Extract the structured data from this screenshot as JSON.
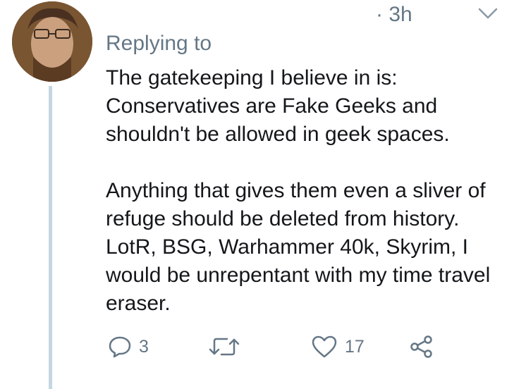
{
  "tweet": {
    "time": "· 3h",
    "replying_label": "Replying to",
    "paragraphs": [
      "The gatekeeping I believe in is: Conservatives are Fake Geeks and shouldn't be allowed in geek spaces.",
      "Anything that gives them even a sliver of refuge should be deleted from history. LotR, BSG, Warhammer 40k, Skyrim, I would be unrepentant with my time travel eraser."
    ],
    "reply_count": "3",
    "retweet_count": "",
    "like_count": "17"
  },
  "icons": {
    "menu": "chevron-down-icon",
    "reply": "speech-bubble-icon",
    "retweet": "retweet-icon",
    "like": "heart-icon",
    "share": "share-icon"
  },
  "colors": {
    "text": "#14171a",
    "muted": "#657786",
    "thread_line": "#c4d6e2"
  }
}
